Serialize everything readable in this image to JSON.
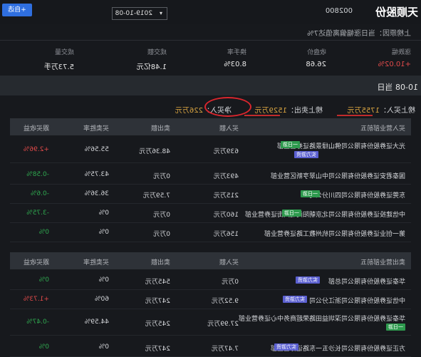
{
  "header": {
    "add_label": "+自选",
    "date_value": "2019-10-08",
    "stock_name": "天顺股份",
    "stock_code": "002800"
  },
  "reason": "上榜原因：当日涨幅偏离值达7%",
  "stats": {
    "change_label": "涨跌幅",
    "change_value": "+10.02%",
    "close_label": "收盘价",
    "close_value": "26.68",
    "turnover_label": "换手率",
    "turnover_value": "8.03%",
    "amount_label": "成交额",
    "amount_value": "1.48亿元",
    "volume_label": "成交量",
    "volume_value": "5.73万手"
  },
  "date_bar": "10-08 当日",
  "summary": {
    "buy_label": "榜上买入：",
    "buy_value": "1755万元",
    "sell_label": "榜上卖出：",
    "sell_value": "1529万元",
    "net_label": "净买入：",
    "net_value": "226万元"
  },
  "buy_table": {
    "headers": [
      "买入营业部前五",
      "买入额",
      "卖出额",
      "买卖胜率",
      "跟买收益"
    ],
    "rows": [
      {
        "name": "光大证券股份有限公司佛山绿景路证券营业部",
        "buy": "639万元",
        "sell": "48.36万元",
        "rate": "55.56%",
        "ret": "+2.96%",
        "badges": [
          "一日游",
          "实力游资"
        ]
      },
      {
        "name": "国泰君安证券股份有限公司中山翠亨新区营业部",
        "buy": "493万元",
        "sell": "0万元",
        "rate": "43.75%",
        "ret": "-0.58%"
      },
      {
        "name": "东莞证券股份有限公司四川分公司",
        "buy": "215万元",
        "sell": "7.59万元",
        "rate": "36.36%",
        "ret": "-0.6%",
        "badges": [
          "一日游"
        ]
      },
      {
        "name": "中信建投证券股份有限公司北京朝阳门北大街证券营业部",
        "buy": "160万元",
        "sell": "0万元",
        "rate": "0%",
        "ret": "-3.75%",
        "badges": [
          "一日游"
        ]
      },
      {
        "name": "第一创业证券股份有限公司杭州教工路证券营业部",
        "buy": "156万元",
        "sell": "0万元",
        "rate": "0%",
        "ret": "0%"
      }
    ]
  },
  "sell_table": {
    "headers": [
      "卖出营业部前五",
      "买入额",
      "卖出额",
      "买卖胜率",
      "跟买收益"
    ],
    "rows": [
      {
        "name": "华泰证券股份有限公司总部",
        "buy": "0万元",
        "sell": "545万元",
        "rate": "0%",
        "ret": "0%",
        "badges": [
          "实力游资"
        ]
      },
      {
        "name": "中信证券股份有限公司浙江分公司",
        "buy": "9.52万元",
        "sell": "247万元",
        "rate": "60%",
        "ret": "+1.73%",
        "badges": [
          "实力游资"
        ]
      },
      {
        "name": "华泰证券股份有限公司深圳益田路荣超商务中心证券营业部",
        "buy": "27.99万元",
        "sell": "245万元",
        "rate": "44.59%",
        "ret": "-0.47%",
        "badges": [
          "一日游"
        ]
      },
      {
        "name": "方正证券股份有限公司长沙五一东路证券营业部",
        "buy": "7.47万元",
        "sell": "247万元",
        "rate": "0%",
        "ret": "0%",
        "badges": [
          "实力游资"
        ]
      }
    ]
  }
}
